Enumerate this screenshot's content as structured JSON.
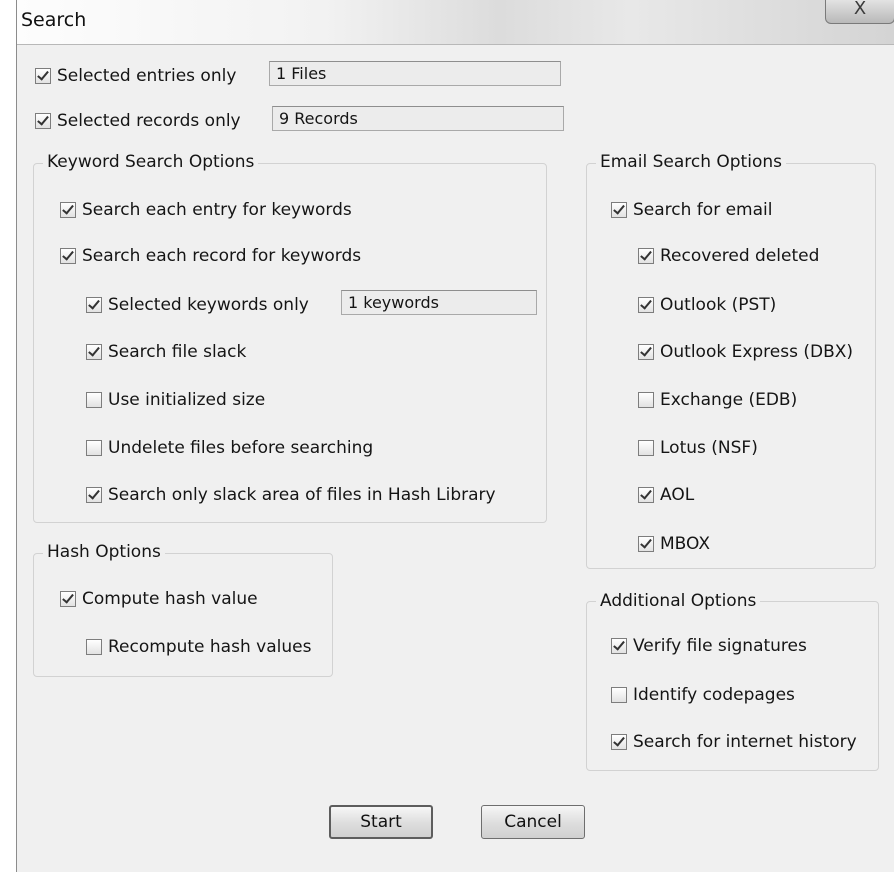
{
  "window": {
    "title": "Search",
    "close_glyph": "X"
  },
  "top": {
    "entries": {
      "label": "Selected entries only",
      "checked": true,
      "value": "1 Files"
    },
    "records": {
      "label": "Selected records only",
      "checked": true,
      "value": "9 Records"
    }
  },
  "keyword": {
    "title": "Keyword Search Options",
    "each_entry": {
      "label": "Search each entry for keywords",
      "checked": true
    },
    "each_record": {
      "label": "Search each record for keywords",
      "checked": true
    },
    "selected_keywords": {
      "label": "Selected keywords only",
      "checked": true,
      "value": "1 keywords"
    },
    "file_slack": {
      "label": "Search file slack",
      "checked": true
    },
    "init_size": {
      "label": "Use initialized size",
      "checked": false
    },
    "undelete": {
      "label": "Undelete files before searching",
      "checked": false
    },
    "slack_hash": {
      "label": "Search only slack area of files in Hash Library",
      "checked": true
    }
  },
  "hash": {
    "title": "Hash Options",
    "compute": {
      "label": "Compute hash value",
      "checked": true
    },
    "recompute": {
      "label": "Recompute hash values",
      "checked": false
    }
  },
  "email": {
    "title": "Email Search Options",
    "search_email": {
      "label": "Search for email",
      "checked": true
    },
    "recovered": {
      "label": "Recovered deleted",
      "checked": true
    },
    "pst": {
      "label": "Outlook (PST)",
      "checked": true
    },
    "dbx": {
      "label": "Outlook Express (DBX)",
      "checked": true
    },
    "edb": {
      "label": "Exchange (EDB)",
      "checked": false
    },
    "nsf": {
      "label": "Lotus (NSF)",
      "checked": false
    },
    "aol": {
      "label": "AOL",
      "checked": true
    },
    "mbox": {
      "label": "MBOX",
      "checked": true
    }
  },
  "additional": {
    "title": "Additional Options",
    "signatures": {
      "label": "Verify file signatures",
      "checked": true
    },
    "codepages": {
      "label": "Identify codepages",
      "checked": false
    },
    "internet": {
      "label": "Search for internet history",
      "checked": true
    }
  },
  "buttons": {
    "start": "Start",
    "cancel": "Cancel"
  }
}
